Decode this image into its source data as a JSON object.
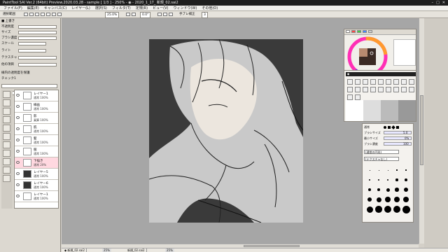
{
  "window": {
    "title": "PaintTool SAI Ver.2 (64bit) Preview.2020.03.28 - sample [ 1/3 ] - 250% - ◉ - 2020_1_17_ 新規_02.sai2"
  },
  "menubar": {
    "items": [
      "ファイル(F)",
      "編集(E)",
      "キャンバス(C)",
      "レイヤー(L)",
      "選択(S)",
      "フィルタ(T)",
      "定規(R)",
      "ビュー(V)",
      "ウィンドウ(W)",
      "その他(O)"
    ]
  },
  "toolbar": {
    "selection_label": "選択範囲",
    "zoom_value": "25.0%",
    "rotation_value": "0.0°",
    "stabilizer_label": "手ブレ補正",
    "stabilizer_value": "3"
  },
  "left_panel": {
    "header": "■ 上書き",
    "rows": [
      "不透明度",
      "サイズ",
      "ブラシ濃度",
      "スケール",
      "ライト",
      "テクスチャ",
      "他の項目"
    ],
    "checks": [
      "線内の透明度を保護",
      "チェック1"
    ]
  },
  "layers": [
    {
      "name": "レイヤー1",
      "mode": "通常 100%"
    },
    {
      "name": "線画",
      "mode": "通常 100%"
    },
    {
      "name": "影",
      "mode": "乗算 100%"
    },
    {
      "name": "肌",
      "mode": "通常 100%"
    },
    {
      "name": "髪",
      "mode": "通常 100%"
    },
    {
      "name": "服",
      "mode": "通常 100%"
    },
    {
      "name": "下描き",
      "mode": "通常 20%"
    },
    {
      "name": "レイヤー5",
      "mode": "通常 100%"
    },
    {
      "name": "レイヤー6",
      "mode": "通常 100%"
    },
    {
      "name": "レイヤー1",
      "mode": "通常 100%"
    }
  ],
  "brush_panel": {
    "mode_label": "通常",
    "rows": [
      {
        "label": "ブラシサイズ",
        "value": "5.0"
      },
      {
        "label": "最小サイズ",
        "value": "0%"
      },
      {
        "label": "ブラシ濃度",
        "value": "100"
      }
    ],
    "dropdown1": "(通常の円形)",
    "dropdown2": "(テクスチャなし)"
  },
  "status_bar": {
    "tabs": [
      {
        "name": "◆ 新規_02.sai2",
        "zoom": "25%"
      },
      {
        "name": "新規_02.sai2",
        "zoom": "25%"
      }
    ]
  },
  "colors": {
    "accent": "#ff2fb5",
    "canvas_bg": "#3a3a3a",
    "sketch": "#d0d0d0"
  }
}
